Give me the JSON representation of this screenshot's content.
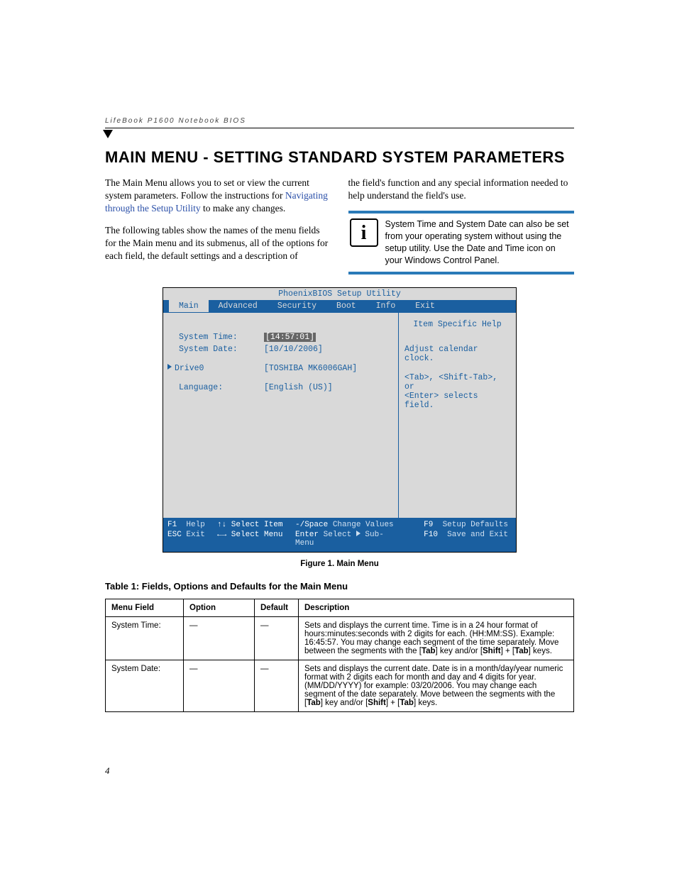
{
  "running_head": "LifeBook P1600 Notebook BIOS",
  "title": "MAIN MENU - SETTING STANDARD SYSTEM PARAMETERS",
  "para1a": "The Main Menu allows you to set or view the current system parameters. Follow the instructions for ",
  "para1_link": "Navigating through the Setup Utility",
  "para1b": " to make any changes.",
  "para2": "The following tables show the names of the menu fields for the Main menu and its submenus, all of the options for each field, the default settings and a description of",
  "para2_cont": "the field's function and any special information needed to help understand the field's use.",
  "note_text": "System Time and System Date can also be set from your operating system without using the setup utility. Use the Date and Time icon on your Windows Control Panel.",
  "bios": {
    "utility_title": "PhoenixBIOS Setup Utility",
    "tabs": [
      "Main",
      "Advanced",
      "Security",
      "Boot",
      "Info",
      "Exit"
    ],
    "rows": {
      "time_label": "System Time:",
      "time_value": "[14:57:01]",
      "date_label": "System Date:",
      "date_value": "[10/10/2006]",
      "drive_label": "Drive0",
      "drive_value": "[TOSHIBA MK6006GAH]",
      "lang_label": "Language:",
      "lang_value": "[English (US)]"
    },
    "help": {
      "title": "Item Specific Help",
      "line1": "Adjust calendar clock.",
      "line2": "<Tab>, <Shift-Tab>, or",
      "line3": "<Enter> selects field."
    },
    "footer": {
      "f1": "F1",
      "help": "Help",
      "arrows_v": "↑↓ Select Item",
      "minus": "-/Space",
      "change": "Change Values",
      "f9": "F9",
      "setup": "Setup Defaults",
      "esc": "ESC",
      "exit": "Exit",
      "arrows_h": "←→ Select Menu",
      "enter": "Enter",
      "select": "Select    Sub-Menu",
      "f10": "F10",
      "save": "Save and Exit"
    }
  },
  "figure_caption": "Figure 1.  Main Menu",
  "table_title": "Table 1: Fields, Options and Defaults for the Main Menu",
  "table_headers": [
    "Menu Field",
    "Option",
    "Default",
    "Description"
  ],
  "table_rows": [
    {
      "field": "System Time:",
      "option": "—",
      "default": "—",
      "desc_parts": [
        "Sets and displays the current time. Time is in a 24 hour format of hours:minutes:seconds with 2 digits for each. (HH:MM:SS). Example: 16:45:57. You may change each segment of the time separately. Move between the segments with the [",
        "Tab",
        "] key and/or [",
        "Shift",
        "] + [",
        "Tab",
        "] keys."
      ]
    },
    {
      "field": "System Date:",
      "option": "—",
      "default": "—",
      "desc_parts": [
        "Sets and displays the current date. Date is in a month/day/year numeric format with 2 digits each for month and day and 4 digits for year. (MM/DD/YYYY) for example: 03/20/2006. You may change each segment of the date separately. Move between the segments with the [",
        "Tab",
        "] key and/or [",
        "Shift",
        "] + [",
        "Tab",
        "] keys."
      ]
    }
  ],
  "page_number": "4"
}
